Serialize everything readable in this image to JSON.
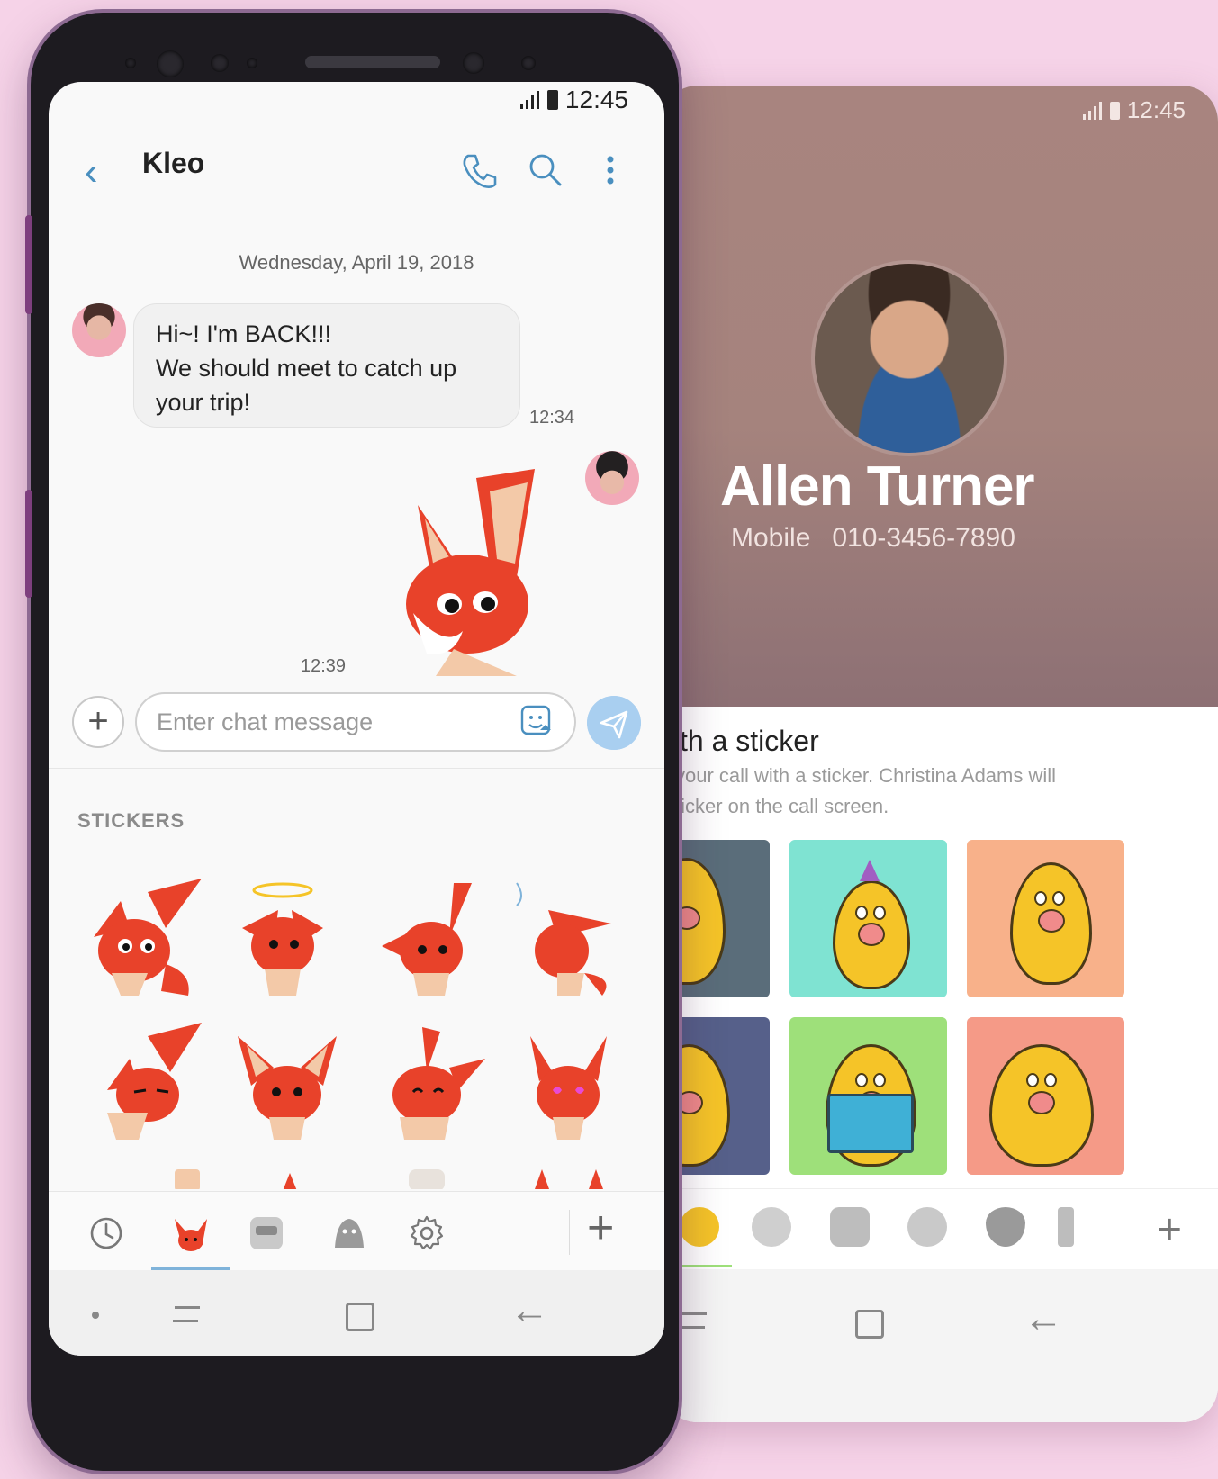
{
  "colors": {
    "background": "#f6d3e8",
    "accent": "#4a8fbf",
    "send_button": "#a9cff0",
    "fox_red": "#e8422a",
    "blob_yellow": "#f5c428"
  },
  "back_screen": {
    "status_time": "12:45",
    "contact": {
      "name": "Allen Turner",
      "phone_type": "Mobile",
      "phone_number": "010-3456-7890"
    },
    "sticker_section": {
      "title": "th a sticker",
      "description_line1": "your call with a sticker. Christina Adams will",
      "description_line2": "ticker on the call screen."
    },
    "tiles": [
      {
        "bg": "#5a6d7a"
      },
      {
        "bg": "#7fe3d2"
      },
      {
        "bg": "#f8b18a"
      },
      {
        "bg": "#56608a"
      },
      {
        "bg": "#9ee07a"
      },
      {
        "bg": "#f59a87"
      }
    ],
    "tab_icons": [
      "blob-sticker-icon",
      "monkey-sticker-icon",
      "robot-sticker-icon",
      "character-sticker-icon",
      "heart-sticker-icon",
      "more-sticker-icon"
    ],
    "plus_label": "+"
  },
  "front_screen": {
    "status_time": "12:45",
    "app_bar": {
      "back_icon": "chevron-left-icon",
      "title": "Kleo",
      "icons": [
        "phone-icon",
        "search-icon",
        "more-vert-icon"
      ]
    },
    "date_separator": "Wednesday, April 19, 2018",
    "messages": [
      {
        "direction": "incoming",
        "lines": [
          "Hi~! I'm BACK!!!",
          "We should meet to catch up",
          "your trip!"
        ],
        "time": "12:34"
      },
      {
        "direction": "outgoing",
        "type": "sticker",
        "sticker": "fox-sticker",
        "time": "12:39"
      }
    ],
    "composer": {
      "add_label": "+",
      "placeholder": "Enter chat message",
      "value": "",
      "sticker_icon": "sticker-icon",
      "send_icon": "send-icon"
    },
    "stickers_panel": {
      "label": "STICKERS",
      "sticker_count_visible": 8,
      "stickers": [
        "fox-surprised",
        "fox-halo",
        "fox-looking",
        "fox-sneeze",
        "fox-sly",
        "fox-shy",
        "fox-happy",
        "fox-love"
      ]
    },
    "tab_bar": {
      "tabs": [
        "clock-icon",
        "fox-tab-icon",
        "character-tab-icon",
        "ghost-tab-icon",
        "settings-icon"
      ],
      "selected": 1,
      "plus_label": "+"
    },
    "nav_bar": [
      "dot-icon",
      "recent-apps-icon",
      "home-icon",
      "back-icon"
    ]
  }
}
